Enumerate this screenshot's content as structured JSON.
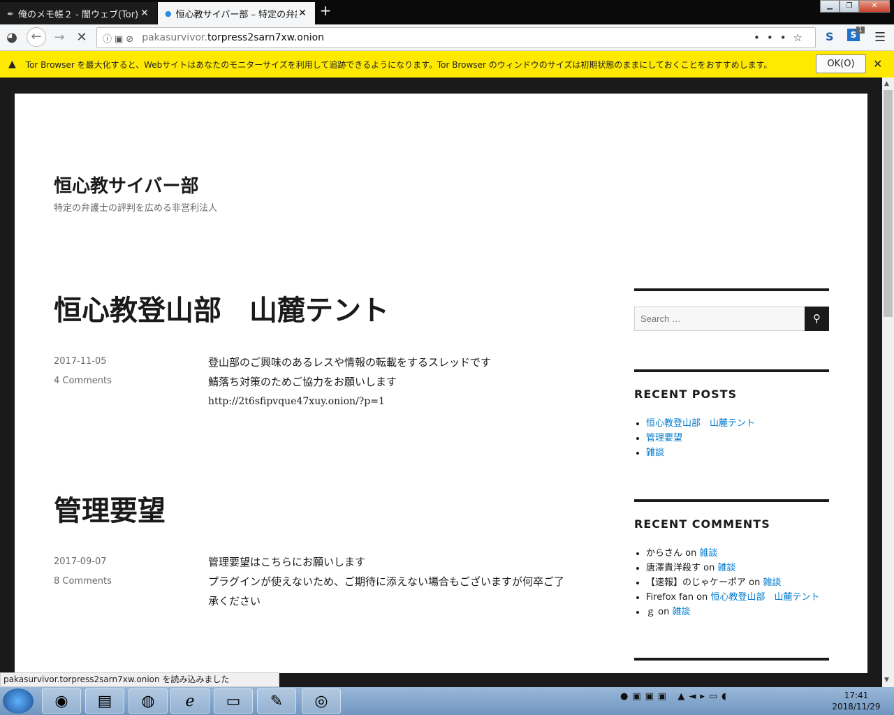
{
  "tabs": [
    {
      "title": "俺のメモ帳２ - 闇ウェブ(Tor)"
    },
    {
      "title": "恒心教サイバー部 – 特定の弁護"
    }
  ],
  "url": {
    "prefix": "pakasurvivor.",
    "main": "torpress2sarn7xw.onion"
  },
  "extensions": {
    "s_label": "S",
    "s2_label": "S",
    "badge": "1"
  },
  "notice": {
    "text": "Tor Browser を最大化すると、Webサイトはあなたのモニターサイズを利用して追跡できるようになります。Tor Browser のウィンドウのサイズは初期状態のままにしておくことをおすすめします。",
    "ok": "OK(O)"
  },
  "site": {
    "title": "恒心教サイバー部",
    "description": "特定の弁護士の評判を広める非営利法人"
  },
  "posts": [
    {
      "title": "恒心教登山部　山麓テント",
      "date": "2017-11-05",
      "comments": "4 Comments",
      "lines": [
        "登山部のご興味のあるレスや情報の転載をするスレッドです",
        "鯖落ち対策のためご協力をお願いします",
        "http://2t6sfipvque47xuy.onion/?p=1"
      ]
    },
    {
      "title": "管理要望",
      "date": "2017-09-07",
      "comments": "8 Comments",
      "lines": [
        "管理要望はこちらにお願いします",
        "プラグインが使えないため、ご期待に添えない場合もございますが何卒ご了",
        "承ください"
      ]
    }
  ],
  "sidebar": {
    "search_placeholder": "Search …",
    "recent_posts_title": "RECENT POSTS",
    "recent_posts": [
      "恒心教登山部　山麓テント",
      "管理要望",
      "雑談"
    ],
    "recent_comments_title": "RECENT COMMENTS",
    "recent_comments": [
      {
        "author": "からさん",
        "on": "on",
        "post": "雑談"
      },
      {
        "author": "唐澤貴洋殺す",
        "on": "on",
        "post": "雑談"
      },
      {
        "author": "【速報】のじゃケーポア",
        "on": "on",
        "post": "雑談"
      },
      {
        "author": "Firefox fan",
        "on": "on",
        "post": "恒心教登山部　山麓テント"
      },
      {
        "author": "ｇ",
        "on": "on",
        "post": "雑談"
      }
    ]
  },
  "status": "pakasurvivor.torpress2sarn7xw.onion を読み込みました",
  "taskbar": {
    "time": "17:41",
    "date": "2018/11/29"
  }
}
